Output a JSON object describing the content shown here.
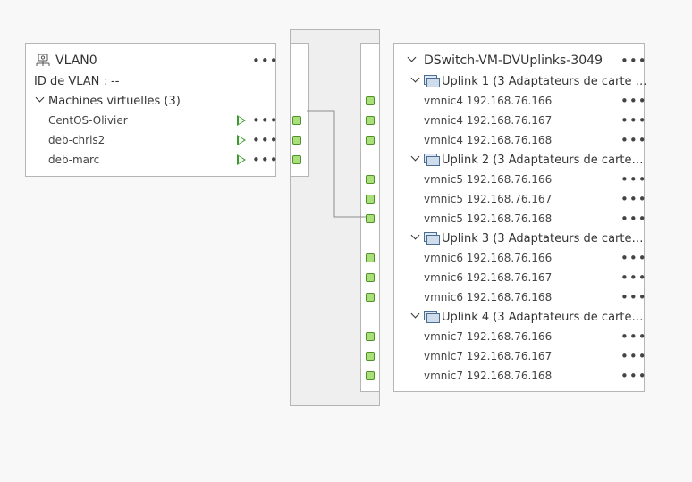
{
  "vlan": {
    "title": "VLAN0",
    "icon": "distributed-port-group-icon",
    "vlan_id_label": "ID de VLAN : --",
    "vm_group_label": "Machines virtuelles (3)",
    "vms": [
      {
        "name": "CentOS-Olivier"
      },
      {
        "name": "deb-chris2"
      },
      {
        "name": "deb-marc"
      }
    ]
  },
  "uplinks": {
    "title": "DSwitch-VM-DVUplinks-3049",
    "groups": [
      {
        "label": "Uplink 1 (3 Adaptateurs de carte …",
        "nics": [
          "vmnic4 192.168.76.166",
          "vmnic4 192.168.76.167",
          "vmnic4 192.168.76.168"
        ]
      },
      {
        "label": "Uplink 2 (3 Adaptateurs de carte…",
        "nics": [
          "vmnic5 192.168.76.166",
          "vmnic5 192.168.76.167",
          "vmnic5 192.168.76.168"
        ]
      },
      {
        "label": "Uplink 3 (3 Adaptateurs de carte…",
        "nics": [
          "vmnic6 192.168.76.166",
          "vmnic6 192.168.76.167",
          "vmnic6 192.168.76.168"
        ]
      },
      {
        "label": "Uplink 4 (3 Adaptateurs de carte…",
        "nics": [
          "vmnic7 192.168.76.166",
          "vmnic7 192.168.76.167",
          "vmnic7 192.168.76.168"
        ]
      }
    ]
  },
  "colors": {
    "port_fill": "#a9e07a",
    "play_green": "#3b9a2b",
    "switch_bg": "#efefef"
  }
}
